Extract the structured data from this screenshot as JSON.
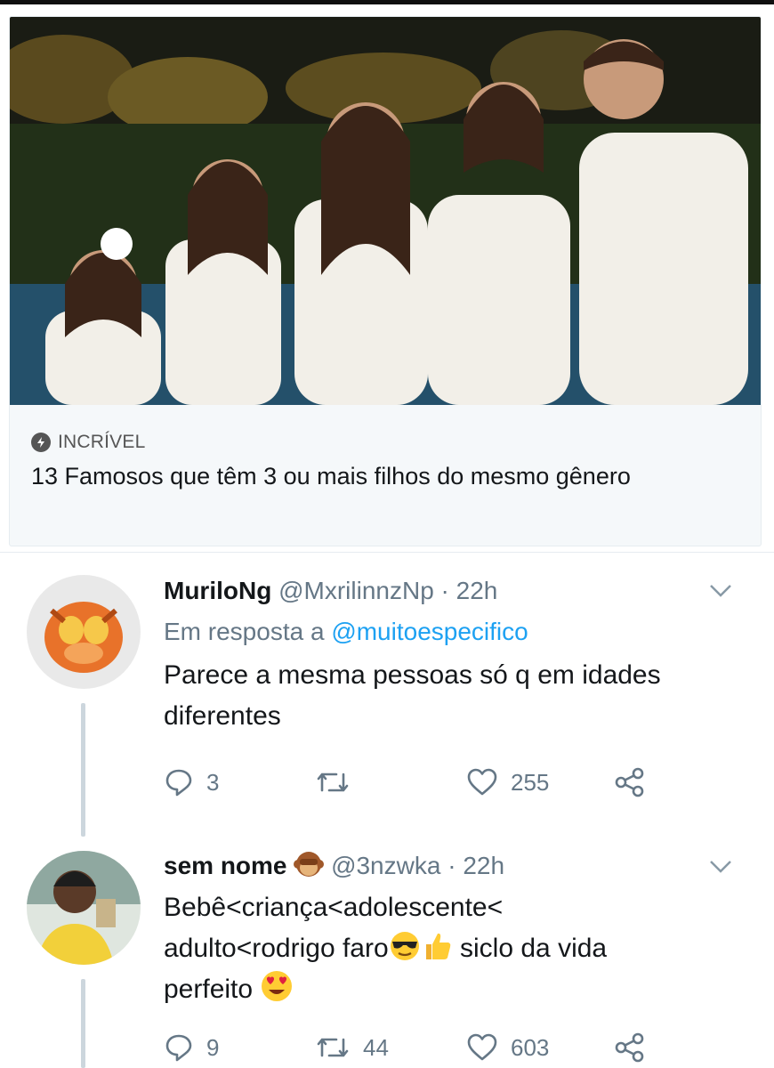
{
  "card": {
    "source": "INCRÍVEL",
    "title": "13 Famosos que têm 3 ou mais filhos do mesmo gênero",
    "image_icon": "family-photo",
    "source_icon": "lightning-icon"
  },
  "tweets": [
    {
      "display_name": "MuriloNg",
      "handle": "@MxrilinnzNp",
      "dot": "·",
      "time": "22h",
      "reply_prefix": "Em resposta a",
      "reply_to": "@muitoespecifico",
      "text": "Parece a mesma pessoas só q em idades diferentes",
      "replies": "3",
      "retweets": "",
      "likes": "255"
    },
    {
      "display_name": "sem nome",
      "name_emoji": "monkey-emoji",
      "handle": "@3nzwka",
      "dot": "·",
      "time": "22h",
      "text_line1": "Bebê<criança<adolescente<",
      "text_line2a": "adulto<rodrigo faro",
      "text_line2b": "siclo da vida",
      "text_line3": "perfeito",
      "replies": "9",
      "retweets": "44",
      "likes": "603"
    }
  ],
  "colors": {
    "text": "#14171a",
    "muted": "#657786",
    "link": "#1da1f2",
    "thread_line": "#ccd6dd",
    "card_bg": "#f5f8fa"
  }
}
